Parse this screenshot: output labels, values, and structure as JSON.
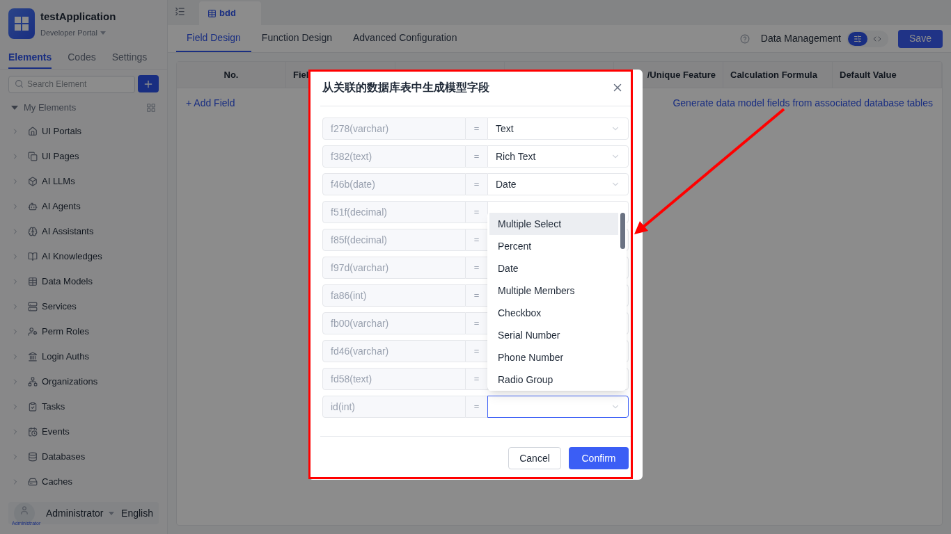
{
  "app": {
    "name": "testApplication",
    "portal": "Developer Portal"
  },
  "sidebar_tabs": [
    {
      "label": "Elements",
      "selected": true
    },
    {
      "label": "Codes",
      "selected": false
    },
    {
      "label": "Settings",
      "selected": false
    }
  ],
  "search": {
    "placeholder": "Search Element"
  },
  "tree": {
    "label": "My Elements",
    "expanded": true,
    "items": [
      {
        "label": "UI Portals",
        "kind": "portal"
      },
      {
        "label": "UI Pages",
        "kind": "pages"
      },
      {
        "label": "AI LLMs",
        "kind": "llm"
      },
      {
        "label": "AI Agents",
        "kind": "agent"
      },
      {
        "label": "AI Assistants",
        "kind": "assistant"
      },
      {
        "label": "AI Knowledges",
        "kind": "knowledge"
      },
      {
        "label": "Data Models",
        "kind": "table"
      },
      {
        "label": "Services",
        "kind": "service"
      },
      {
        "label": "Perm Roles",
        "kind": "role"
      },
      {
        "label": "Login Auths",
        "kind": "auth"
      },
      {
        "label": "Organizations",
        "kind": "org"
      },
      {
        "label": "Tasks",
        "kind": "task"
      },
      {
        "label": "Events",
        "kind": "event"
      },
      {
        "label": "Databases",
        "kind": "database"
      },
      {
        "label": "Caches",
        "kind": "cache"
      }
    ]
  },
  "user": {
    "avatar_label": "Administrator",
    "name": "Administrator",
    "language": "English"
  },
  "doc_tab": {
    "label": "bdd"
  },
  "tabs": [
    {
      "label": "Field Design",
      "selected": true
    },
    {
      "label": "Function Design",
      "selected": false
    },
    {
      "label": "Advanced Configuration",
      "selected": false
    }
  ],
  "toolbar": {
    "label": "Data Management",
    "save": "Save",
    "views": [
      {
        "kind": "sliders",
        "selected": true
      },
      {
        "kind": "code",
        "selected": false
      }
    ]
  },
  "table": {
    "columns": [
      "No.",
      "Fiel",
      "",
      "",
      "/Unique Feature",
      "Calculation Formula",
      "Default Value"
    ],
    "add_field": "+ Add Field",
    "generate_link": "Generate data model fields from associated database tables"
  },
  "dialog": {
    "title": "从关联的数据库表中生成模型字段",
    "rows": [
      {
        "source": "f278(varchar)",
        "equals": "=",
        "value": "Text",
        "focused": false
      },
      {
        "source": "f382(text)",
        "equals": "=",
        "value": "Rich Text",
        "focused": false
      },
      {
        "source": "f46b(date)",
        "equals": "=",
        "value": "Date",
        "focused": false
      },
      {
        "source": "f51f(decimal)",
        "equals": "=",
        "focused": false
      },
      {
        "source": "f85f(decimal)",
        "equals": "=",
        "focused": false
      },
      {
        "source": "f97d(varchar)",
        "equals": "=",
        "focused": false
      },
      {
        "source": "fa86(int)",
        "equals": "=",
        "focused": false
      },
      {
        "source": "fb00(varchar)",
        "equals": "=",
        "focused": false
      },
      {
        "source": "fd46(varchar)",
        "equals": "=",
        "focused": false
      },
      {
        "source": "fd58(text)",
        "equals": "=",
        "focused": false
      },
      {
        "source": "id(int)",
        "equals": "=",
        "focused": true
      }
    ],
    "options": [
      {
        "label": "Multiple Select",
        "active": true
      },
      {
        "label": "Percent",
        "active": false
      },
      {
        "label": "Date",
        "active": false
      },
      {
        "label": "Multiple Members",
        "active": false
      },
      {
        "label": "Checkbox",
        "active": false
      },
      {
        "label": "Serial Number",
        "active": false
      },
      {
        "label": "Phone Number",
        "active": false
      },
      {
        "label": "Radio Group",
        "active": false
      }
    ],
    "cancel": "Cancel",
    "confirm": "Confirm"
  }
}
